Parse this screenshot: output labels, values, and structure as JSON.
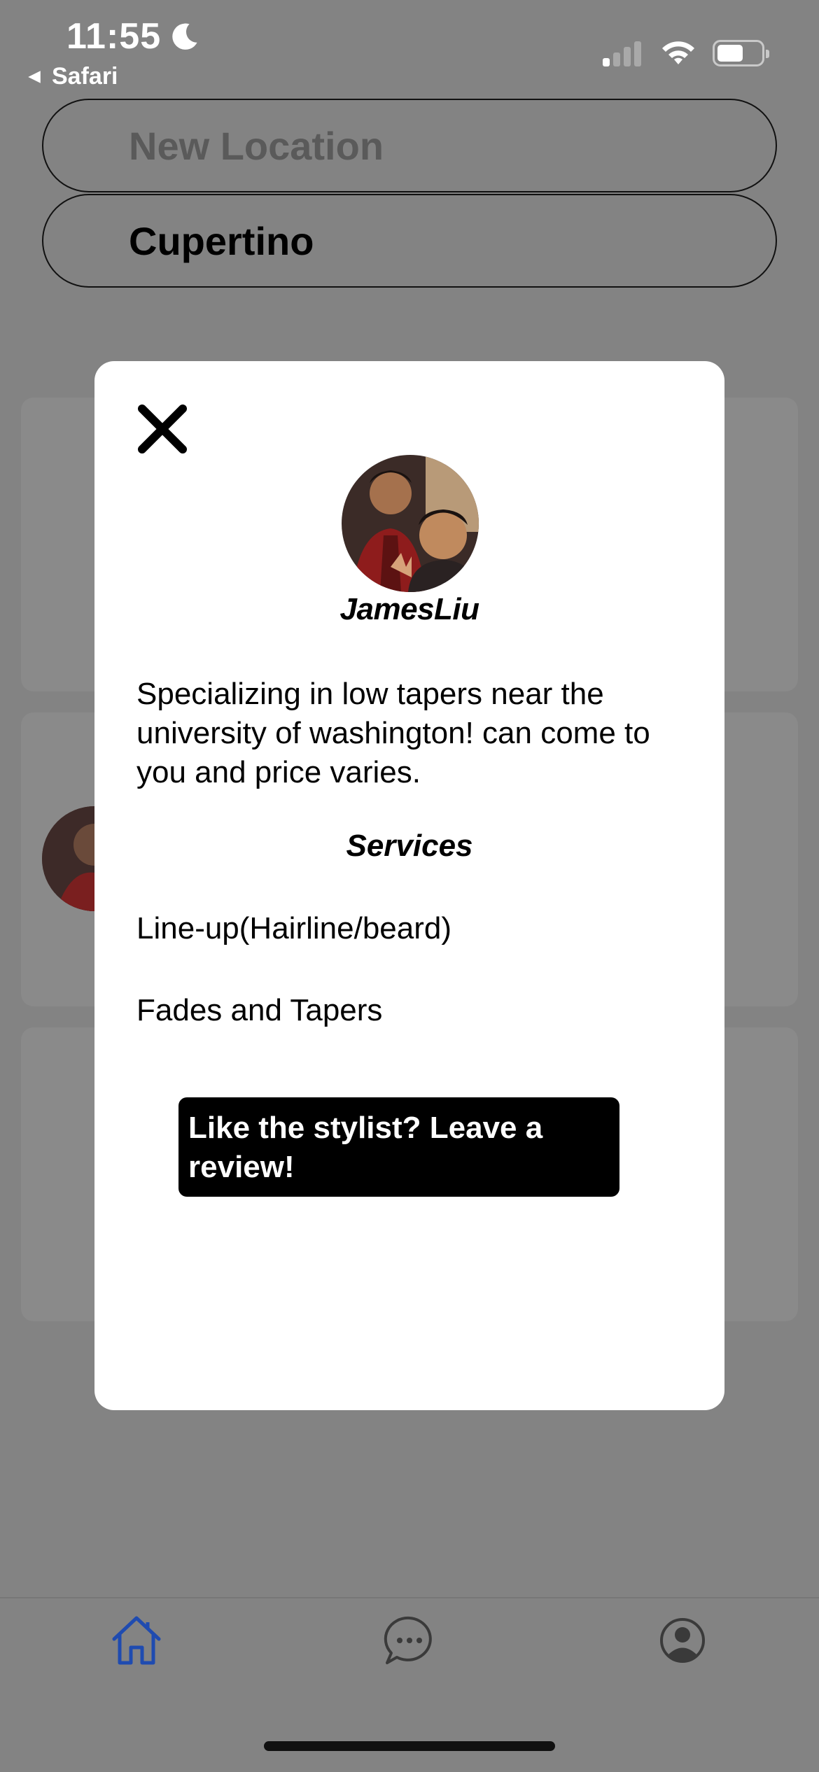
{
  "status_bar": {
    "time": "11:55",
    "back_app": "Safari"
  },
  "location": {
    "new_placeholder": "New Location",
    "current_value": "Cupertino"
  },
  "modal": {
    "username": "JamesLiu",
    "bio": "Specializing in low tapers near the university of washington! can come to you and price varies.",
    "services_title": "Services",
    "services": [
      "Line-up(Hairline/beard)",
      "Fades and Tapers"
    ],
    "review_button": "Like the stylist? Leave a review!"
  },
  "tabbar": {
    "items": [
      {
        "icon": "home-icon",
        "active": true
      },
      {
        "icon": "chat-icon",
        "active": false
      },
      {
        "icon": "profile-icon",
        "active": false
      }
    ]
  },
  "colors": {
    "overlay_bg": "#838383",
    "active_tab": "#1f4bb0",
    "inactive_tab": "#3a3a3a",
    "button_bg": "#000000"
  }
}
